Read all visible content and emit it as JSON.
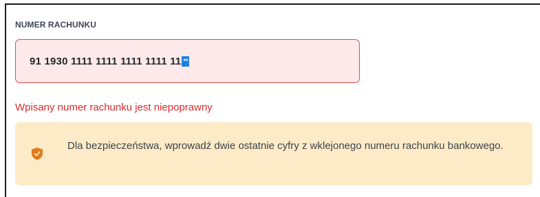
{
  "account_field": {
    "label": "NUMER RACHUNKU",
    "value": "91 1930 1111 1111 1111 1111 11",
    "masked_placeholder": "**"
  },
  "error": {
    "message": "Wpisany numer rachunku jest niepoprawny"
  },
  "info": {
    "icon": "shield-icon",
    "text": "Dla bezpieczeństwa, wprowadź dwie ostatnie cyfry z wklejonego numeru rachunku bankowego."
  },
  "colors": {
    "error_red": "#e0292b",
    "input_error_bg": "#fde9e9",
    "info_bg": "#fdebc8",
    "shield_orange": "#e07a1a",
    "selection_blue": "#1a7fe6"
  }
}
